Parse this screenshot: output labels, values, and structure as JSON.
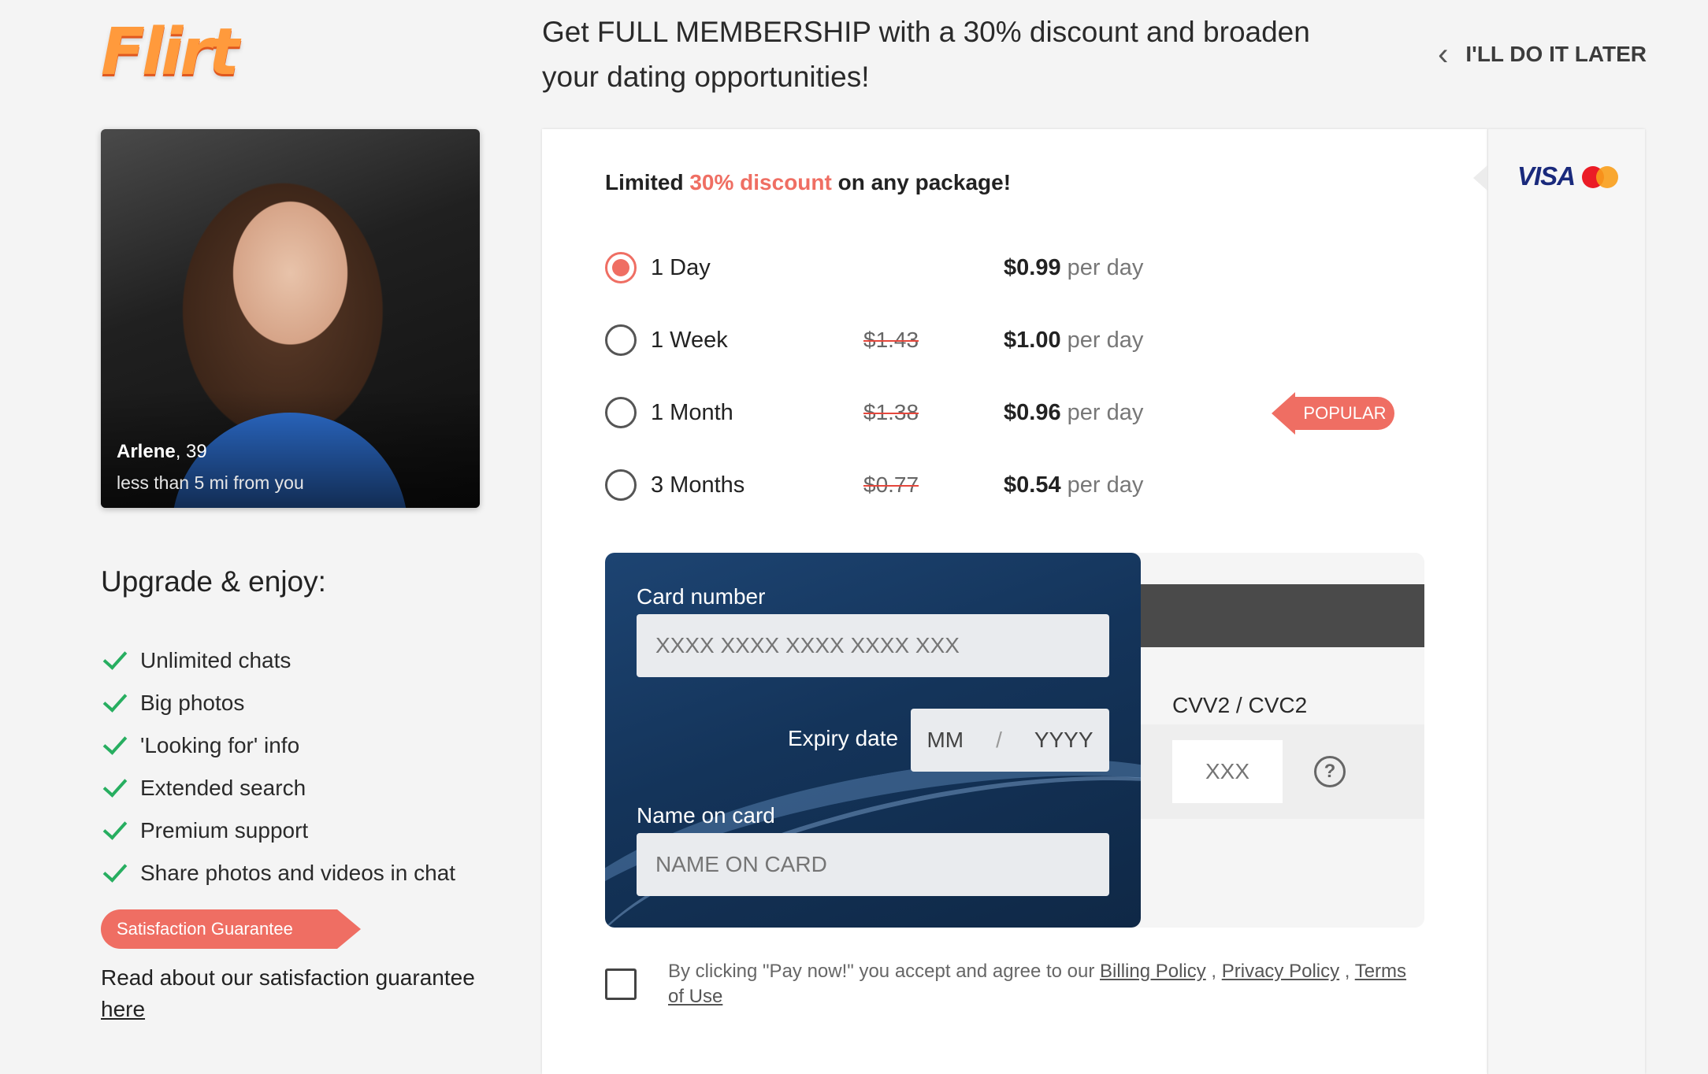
{
  "header": {
    "logo_text": "Flirt",
    "headline": "Get FULL MEMBERSHIP with a 30% discount and broaden your dating opportunities!",
    "later_label": "I'LL DO IT LATER"
  },
  "profile": {
    "name": "Arlene",
    "age": ", 39",
    "distance": "less than 5 mi from you"
  },
  "upgrade": {
    "title": "Upgrade & enjoy:",
    "features": [
      "Unlimited chats",
      "Big photos",
      "'Looking for' info",
      "Extended search",
      "Premium support",
      "Share photos and videos in chat"
    ],
    "guarantee_badge": "Satisfaction Guarantee",
    "guarantee_text": "Read about our satisfaction guarantee",
    "guarantee_link": "here"
  },
  "offer": {
    "limited_prefix": "Limited ",
    "limited_accent": "30% discount",
    "limited_suffix": " on any package!",
    "accent_color": "#ef6e63",
    "packages": [
      {
        "name": "1 Day",
        "old_price": "",
        "price": "$0.99",
        "per": " per day",
        "selected": true
      },
      {
        "name": "1 Week",
        "old_price": "$1.43",
        "price": "$1.00",
        "per": " per day",
        "selected": false
      },
      {
        "name": "1 Month",
        "old_price": "$1.38",
        "price": "$0.96",
        "per": " per day",
        "selected": false
      },
      {
        "name": "3 Months",
        "old_price": "$0.77",
        "price": "$0.54",
        "per": " per day",
        "selected": false
      }
    ],
    "popular_badge": "POPULAR"
  },
  "payment": {
    "brands": {
      "visa": "VISA",
      "mastercard_icon": "mastercard-icon"
    },
    "card_number_label": "Card number",
    "card_number_placeholder": "XXXX XXXX XXXX XXXX XXX",
    "expiry_label": "Expiry date",
    "expiry_month_placeholder": "MM",
    "expiry_separator": "/",
    "expiry_year_placeholder": "YYYY",
    "name_label": "Name on card",
    "name_placeholder": "NAME ON CARD",
    "cvv_label": "CVV2 / CVC2",
    "cvv_placeholder": "XXX",
    "help_icon": "?"
  },
  "terms": {
    "prefix": "By clicking \"Pay now!\" you accept and agree to our ",
    "billing": "Billing Policy",
    "sep1": " , ",
    "privacy": "Privacy Policy",
    "sep2": " , ",
    "tou": "Terms of Use"
  }
}
